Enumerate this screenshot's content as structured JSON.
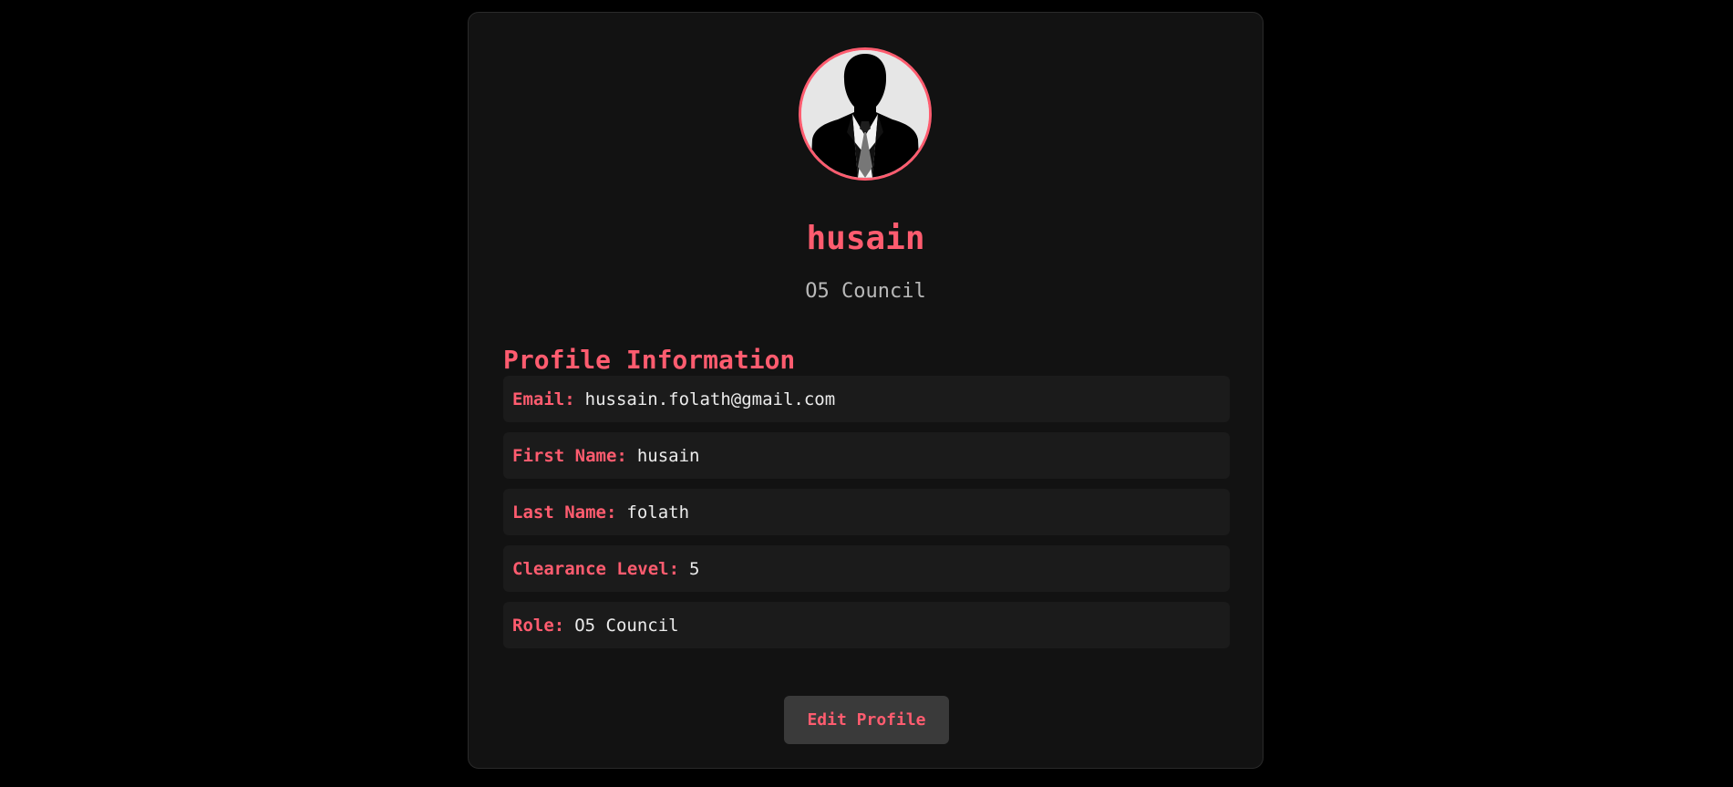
{
  "profile": {
    "username": "husain",
    "subtitle": "O5 Council",
    "avatar_icon": "person-silhouette-icon"
  },
  "info": {
    "title": "Profile Information",
    "rows": [
      {
        "label": "Email:",
        "value": "hussain.folath@gmail.com"
      },
      {
        "label": "First Name:",
        "value": "husain"
      },
      {
        "label": "Last Name:",
        "value": "folath"
      },
      {
        "label": "Clearance Level:",
        "value": "5"
      },
      {
        "label": "Role:",
        "value": "O5 Council"
      }
    ]
  },
  "actions": {
    "edit_label": "Edit Profile"
  },
  "colors": {
    "accent": "#ff5c6f",
    "page_bg": "#000000",
    "card_bg": "#121212",
    "row_bg": "#1b1b1b",
    "button_bg": "#3a3a3a"
  }
}
